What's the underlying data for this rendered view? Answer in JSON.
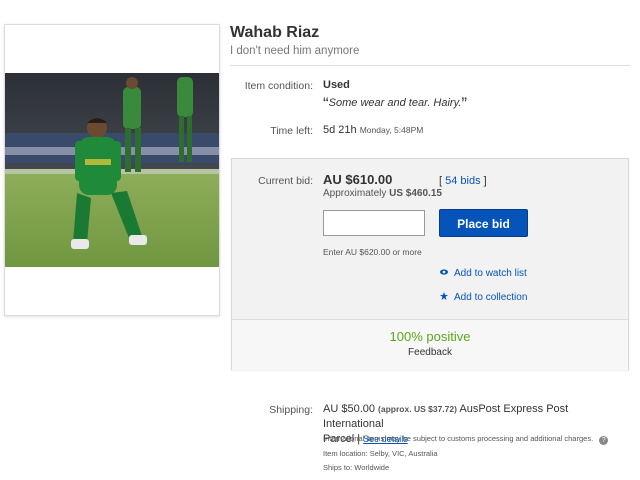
{
  "listing": {
    "title": "Wahab Riaz",
    "subtitle": "I don't need him anymore"
  },
  "condition": {
    "label": "Item condition:",
    "value": "Used",
    "quote_open": "“",
    "note": "Some wear and tear. Hairy.",
    "quote_close": "”"
  },
  "time_left": {
    "label": "Time left:",
    "value": "5d 21h",
    "detail": "Monday, 5:48PM"
  },
  "bid": {
    "label": "Current bid:",
    "price": "AU $610.00",
    "approx_prefix": "Approximately",
    "approx_value": "US $460.15",
    "bids_open": "[",
    "bids_link": "54 bids",
    "bids_close": "]",
    "input_value": "",
    "button_label": "Place bid",
    "hint": "Enter AU $620.00 or more",
    "watch_label": "Add to watch list",
    "collection_label": "Add to collection",
    "feedback_percent": "100% positive",
    "feedback_label": "Feedback"
  },
  "shipping": {
    "label": "Shipping:",
    "price": "AU $50.00",
    "approx": "(approx. US $37.72)",
    "service_1": "AusPost Express Post International",
    "service_2": "Parcel",
    "sep": "|",
    "details_link": "See details",
    "customs_note": "International items may be subject to customs processing and additional charges.",
    "item_location": "Item location:  Selby, VIC, Australia",
    "ships_to": "Ships to:  Worldwide"
  },
  "colors": {
    "link": "#0654ba",
    "button": "#0654ba",
    "positive": "#5ba71b"
  }
}
